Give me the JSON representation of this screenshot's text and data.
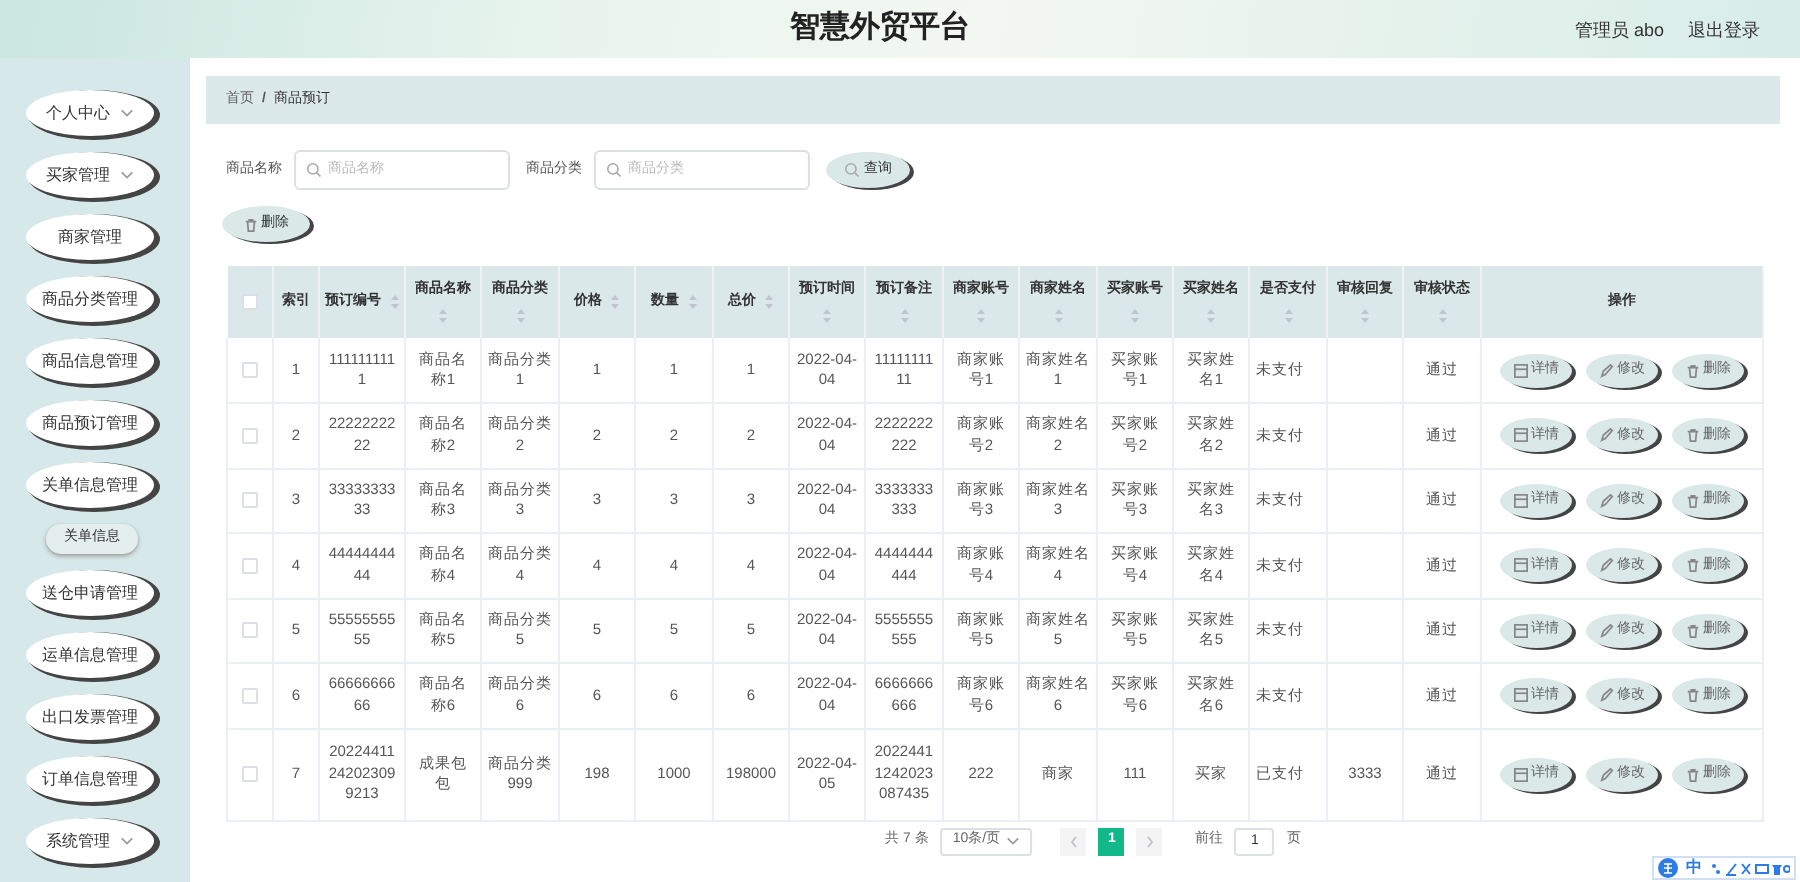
{
  "header": {
    "title": "智慧外贸平台",
    "user": "管理员 abo",
    "logout": "退出登录"
  },
  "sidebar": {
    "items": [
      {
        "label": "个人中心",
        "kind": "dropdown"
      },
      {
        "label": "买家管理",
        "kind": "dropdown"
      },
      {
        "label": "商家管理",
        "kind": "link"
      },
      {
        "label": "商品分类管理",
        "kind": "link"
      },
      {
        "label": "商品信息管理",
        "kind": "link"
      },
      {
        "label": "商品预订管理",
        "kind": "link"
      },
      {
        "label": "关单信息管理",
        "kind": "link",
        "expanded": true,
        "children": [
          {
            "label": "关单信息"
          }
        ]
      },
      {
        "label": "送仓申请管理",
        "kind": "link"
      },
      {
        "label": "运单信息管理",
        "kind": "link"
      },
      {
        "label": "出口发票管理",
        "kind": "link"
      },
      {
        "label": "订单信息管理",
        "kind": "link"
      },
      {
        "label": "系统管理",
        "kind": "dropdown"
      }
    ]
  },
  "breadcrumb": [
    "首页",
    "商品预订"
  ],
  "breadcrumb_separator": "/",
  "search": {
    "fields": [
      {
        "label": "商品名称",
        "placeholder": "商品名称"
      },
      {
        "label": "商品分类",
        "placeholder": "商品分类"
      }
    ],
    "button": "查询"
  },
  "delete_button": "删除",
  "table": {
    "select_all_checked": false,
    "columns": [
      {
        "label": "索引",
        "sortable": false
      },
      {
        "label": "预订编号",
        "sortable": true
      },
      {
        "label": "商品名称",
        "sortable": true
      },
      {
        "label": "商品分类",
        "sortable": true
      },
      {
        "label": "价格",
        "sortable": true
      },
      {
        "label": "数量",
        "sortable": true
      },
      {
        "label": "总价",
        "sortable": true
      },
      {
        "label": "预订时间",
        "sortable": true
      },
      {
        "label": "预订备注",
        "sortable": true
      },
      {
        "label": "商家账号",
        "sortable": true
      },
      {
        "label": "商家姓名",
        "sortable": true
      },
      {
        "label": "买家账号",
        "sortable": true
      },
      {
        "label": "买家姓名",
        "sortable": true
      },
      {
        "label": "是否支付",
        "sortable": true
      },
      {
        "label": "审核回复",
        "sortable": true
      },
      {
        "label": "审核状态",
        "sortable": true
      },
      {
        "label": "操作",
        "sortable": false
      }
    ],
    "rows": [
      {
        "checked": false,
        "cells": [
          "1",
          "1111111111",
          "商品名称1",
          "商品分类1",
          "1",
          "1",
          "1",
          "2022-04-04",
          "1111111111",
          "商家账号1",
          "商家姓名1",
          "买家账号1",
          "买家姓名1",
          "未支付",
          null,
          "通过"
        ],
        "actions": [
          {
            "kind": "detail",
            "label": "详情"
          },
          {
            "kind": "edit",
            "label": "修改"
          },
          {
            "kind": "delete",
            "label": "删除"
          }
        ]
      },
      {
        "checked": false,
        "cells": [
          "2",
          "2222222222",
          "商品名称2",
          "商品分类2",
          "2",
          "2",
          "2",
          "2022-04-04",
          "2222222222",
          "商家账号2",
          "商家姓名2",
          "买家账号2",
          "买家姓名2",
          "未支付",
          null,
          "通过"
        ],
        "actions": [
          {
            "kind": "detail",
            "label": "详情"
          },
          {
            "kind": "edit",
            "label": "修改"
          },
          {
            "kind": "delete",
            "label": "删除"
          }
        ]
      },
      {
        "checked": false,
        "cells": [
          "3",
          "3333333333",
          "商品名称3",
          "商品分类3",
          "3",
          "3",
          "3",
          "2022-04-04",
          "3333333333",
          "商家账号3",
          "商家姓名3",
          "买家账号3",
          "买家姓名3",
          "未支付",
          null,
          "通过"
        ],
        "actions": [
          {
            "kind": "detail",
            "label": "详情"
          },
          {
            "kind": "edit",
            "label": "修改"
          },
          {
            "kind": "delete",
            "label": "删除"
          }
        ]
      },
      {
        "checked": false,
        "cells": [
          "4",
          "4444444444",
          "商品名称4",
          "商品分类4",
          "4",
          "4",
          "4",
          "2022-04-04",
          "4444444444",
          "商家账号4",
          "商家姓名4",
          "买家账号4",
          "买家姓名4",
          "未支付",
          null,
          "通过"
        ],
        "actions": [
          {
            "kind": "detail",
            "label": "详情"
          },
          {
            "kind": "edit",
            "label": "修改"
          },
          {
            "kind": "delete",
            "label": "删除"
          }
        ]
      },
      {
        "checked": false,
        "cells": [
          "5",
          "5555555555",
          "商品名称5",
          "商品分类5",
          "5",
          "5",
          "5",
          "2022-04-04",
          "5555555555",
          "商家账号5",
          "商家姓名5",
          "买家账号5",
          "买家姓名5",
          "未支付",
          null,
          "通过"
        ],
        "actions": [
          {
            "kind": "detail",
            "label": "详情"
          },
          {
            "kind": "edit",
            "label": "修改"
          },
          {
            "kind": "delete",
            "label": "删除"
          }
        ]
      },
      {
        "checked": false,
        "cells": [
          "6",
          "6666666666",
          "商品名称6",
          "商品分类6",
          "6",
          "6",
          "6",
          "2022-04-04",
          "6666666666",
          "商家账号6",
          "商家姓名6",
          "买家账号6",
          "买家姓名6",
          "未支付",
          null,
          "通过"
        ],
        "actions": [
          {
            "kind": "detail",
            "label": "详情"
          },
          {
            "kind": "edit",
            "label": "修改"
          },
          {
            "kind": "delete",
            "label": "删除"
          }
        ]
      },
      {
        "checked": false,
        "cells": [
          "7",
          "20224411242023099213",
          "成果包包",
          "商品分类999",
          "198",
          "1000",
          "198000",
          "2022-04-05",
          "20224411242023087435",
          "222",
          "商家",
          "111",
          "买家",
          "已支付",
          "3333",
          "通过"
        ],
        "actions": [
          {
            "kind": "detail",
            "label": "详情"
          },
          {
            "kind": "edit",
            "label": "修改"
          },
          {
            "kind": "delete",
            "label": "删除"
          }
        ]
      }
    ]
  },
  "pagination": {
    "total": "共 7 条",
    "page_size": "10条/页",
    "pages": [
      {
        "label": "1",
        "selected": true
      }
    ],
    "goto_label": "前往",
    "goto_value": "1",
    "goto_suffix": "页"
  },
  "ime_bar": {
    "mode": "中"
  }
}
